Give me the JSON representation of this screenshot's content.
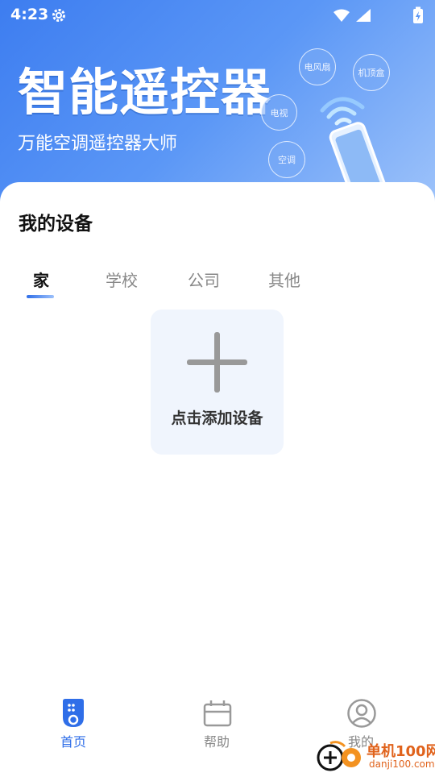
{
  "status_bar": {
    "time": "4:23"
  },
  "hero": {
    "title": "智能遥控器",
    "subtitle": "万能空调遥控器大师",
    "bubbles": [
      "电风扇",
      "机顶盒",
      "电视",
      "空调"
    ]
  },
  "devices": {
    "title": "我的设备",
    "tabs": [
      {
        "label": "家",
        "active": true
      },
      {
        "label": "学校",
        "active": false
      },
      {
        "label": "公司",
        "active": false
      },
      {
        "label": "其他",
        "active": false
      }
    ],
    "add_label": "点击添加设备"
  },
  "bottom_nav": [
    {
      "label": "首页",
      "icon": "remote-icon",
      "active": true
    },
    {
      "label": "帮助",
      "icon": "help-card-icon",
      "active": false
    },
    {
      "label": "我的",
      "icon": "profile-icon",
      "active": false
    }
  ],
  "watermark": {
    "text": "单机100网",
    "url": "danji100.com"
  },
  "colors": {
    "accent": "#2f6ee8",
    "hero_start": "#3d7df0",
    "hero_end": "#9ec3fa",
    "card_bg": "#f0f5fd",
    "watermark": "#e0621b"
  }
}
